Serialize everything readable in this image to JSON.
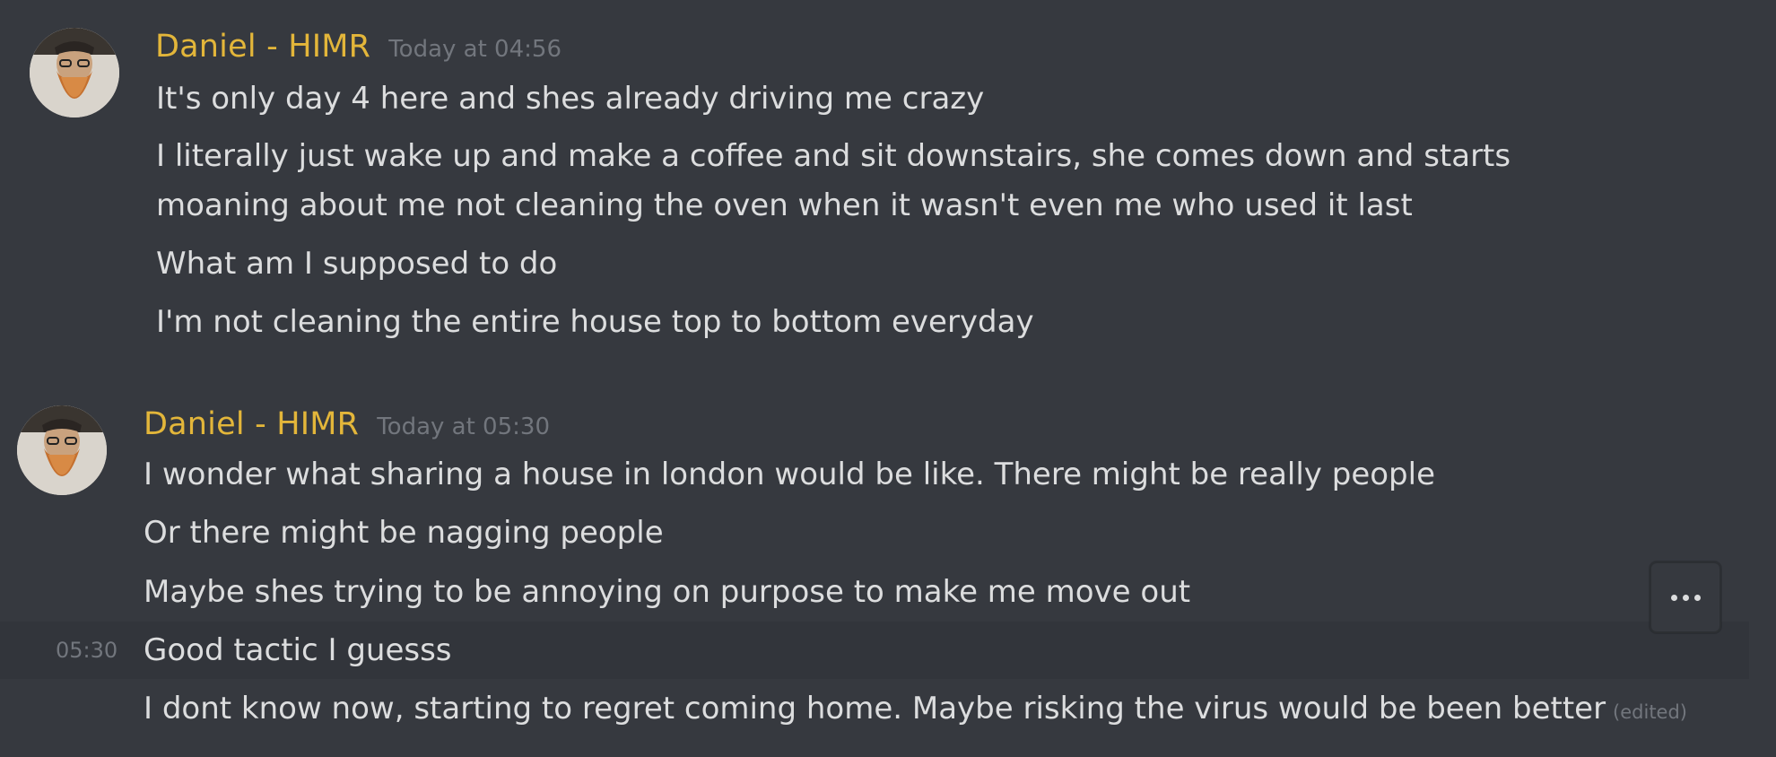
{
  "messages": [
    {
      "username": "Daniel - HIMR",
      "timestamp": "Today at 04:56",
      "lines": [
        "It's only day 4 here and shes already driving me crazy",
        "I literally just wake up and make a coffee and sit downstairs, she comes down and starts moaning about me not cleaning the oven when it wasn't even me who used it last",
        "What am I supposed to do",
        "I'm not cleaning the entire house top to bottom everyday"
      ]
    },
    {
      "username": "Daniel - HIMR",
      "timestamp": "Today at 05:30",
      "lines": [
        "I wonder what sharing a house in london would be like. There might be really people",
        "Or there might be nagging people",
        "Maybe shes trying to be annoying on purpose to make me move out",
        "Good tactic I guesss",
        "I dont know now, starting to regret coming home. Maybe risking the virus would be been better"
      ],
      "hover_time": "05:30",
      "edited_label": "(edited)"
    }
  ],
  "icons": {
    "avatar": "bearded-man-avatar",
    "more": "more-options-icon"
  },
  "colors": {
    "background": "#36393f",
    "username": "#e3b63a",
    "text": "#dcddde",
    "muted": "#72767d"
  }
}
